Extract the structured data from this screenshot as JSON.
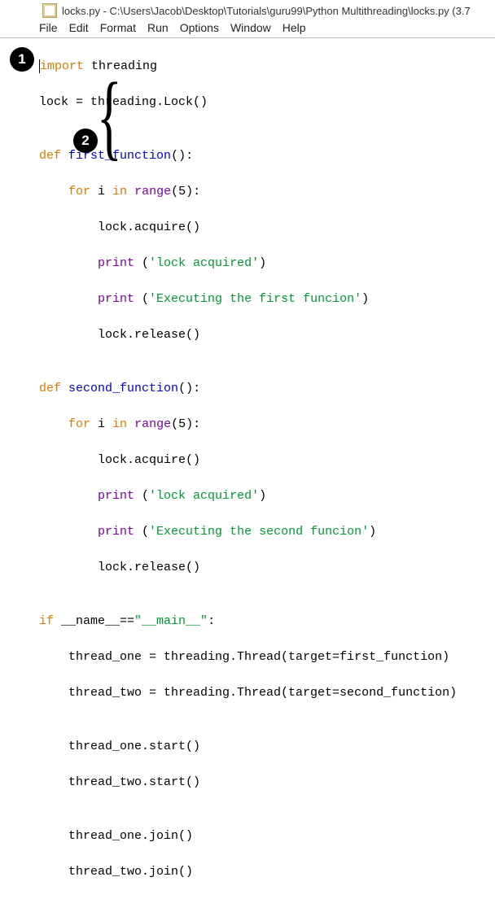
{
  "title": "locks.py - C:\\Users\\Jacob\\Desktop\\Tutorials\\guru99\\Python Multithreading\\locks.py (3.7",
  "menu": {
    "file": "File",
    "edit": "Edit",
    "format": "Format",
    "run": "Run",
    "options": "Options",
    "window": "Window",
    "help": "Help"
  },
  "badges": {
    "one": "1",
    "two": "2"
  },
  "code": {
    "l1a": "import",
    "l1b": " threading",
    "l2": "lock = threading.Lock()",
    "l3": "",
    "l4a": "def",
    "l4b": " ",
    "l4c": "first_function",
    "l4d": "():",
    "l5a": "    ",
    "l5b": "for",
    "l5c": " i ",
    "l5d": "in",
    "l5e": " ",
    "l5f": "range",
    "l5g": "(5):",
    "l6": "        lock.acquire()",
    "l7a": "        ",
    "l7b": "print",
    "l7c": " (",
    "l7d": "'lock acquired'",
    "l7e": ")",
    "l8a": "        ",
    "l8b": "print",
    "l8c": " (",
    "l8d": "'Executing the first funcion'",
    "l8e": ")",
    "l9": "        lock.release()",
    "l10": "",
    "l11a": "def",
    "l11b": " ",
    "l11c": "second_function",
    "l11d": "():",
    "l12a": "    ",
    "l12b": "for",
    "l12c": " i ",
    "l12d": "in",
    "l12e": " ",
    "l12f": "range",
    "l12g": "(5):",
    "l13": "        lock.acquire()",
    "l14a": "        ",
    "l14b": "print",
    "l14c": " (",
    "l14d": "'lock acquired'",
    "l14e": ")",
    "l15a": "        ",
    "l15b": "print",
    "l15c": " (",
    "l15d": "'Executing the second funcion'",
    "l15e": ")",
    "l16": "        lock.release()",
    "l17": "",
    "l18a": "if",
    "l18b": " __name__==",
    "l18c": "\"__main__\"",
    "l18d": ":",
    "l19": "    thread_one = threading.Thread(target=first_function)",
    "l20": "    thread_two = threading.Thread(target=second_function)",
    "l21": "",
    "l22": "    thread_one.start()",
    "l23": "    thread_two.start()",
    "l24": "",
    "l25": "    thread_one.join()",
    "l26": "    thread_two.join()"
  }
}
